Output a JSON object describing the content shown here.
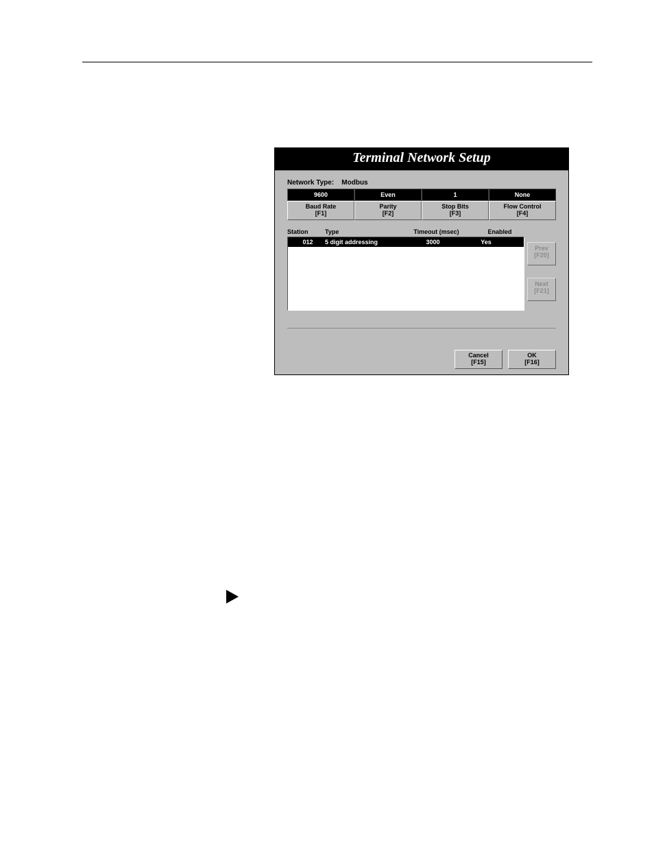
{
  "dialog": {
    "title": "Terminal Network Setup",
    "network_type_label": "Network Type:",
    "network_type_value": "Modbus",
    "top": {
      "baud_value": "9600",
      "baud_label": "Baud Rate",
      "baud_key": "[F1]",
      "parity_value": "Even",
      "parity_label": "Parity",
      "parity_key": "[F2]",
      "stop_value": "1",
      "stop_label": "Stop Bits",
      "stop_key": "[F3]",
      "flow_value": "None",
      "flow_label": "Flow Control",
      "flow_key": "[F4]"
    },
    "headers": {
      "station": "Station",
      "type": "Type",
      "timeout": "Timeout (msec)",
      "enabled": "Enabled"
    },
    "row": {
      "station": "012",
      "type": "5 digit addressing",
      "timeout": "3000",
      "enabled": "Yes"
    },
    "side": {
      "prev_label": "Prev",
      "prev_key": "[F20]",
      "next_label": "Next",
      "next_key": "[F21]"
    },
    "bottom": {
      "cancel_label": "Cancel",
      "cancel_key": "[F15]",
      "ok_label": "OK",
      "ok_key": "[F16]"
    }
  }
}
